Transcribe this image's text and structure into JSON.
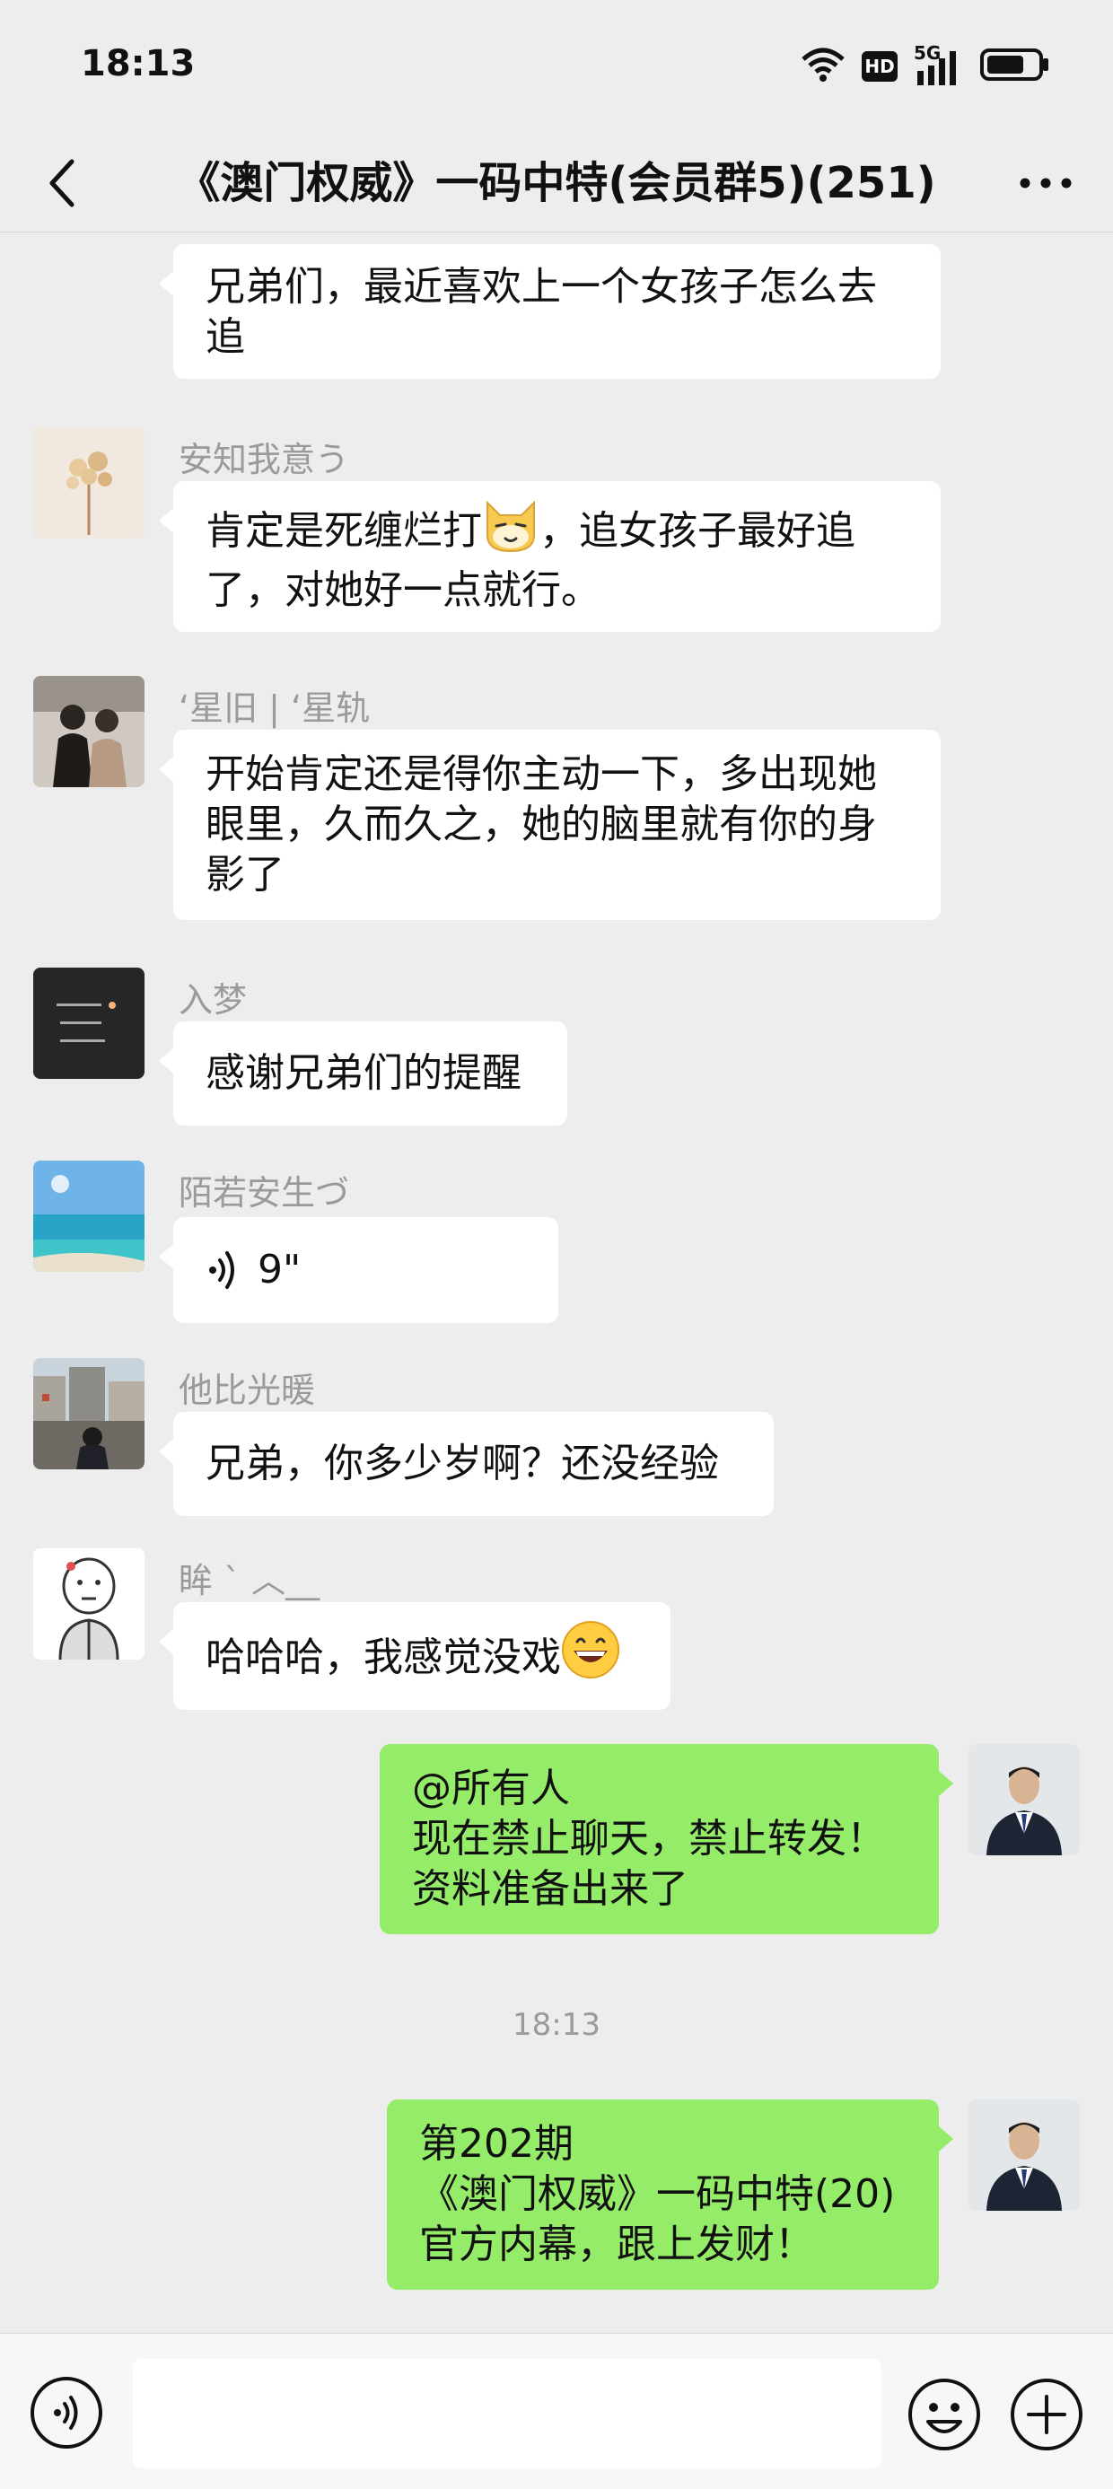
{
  "status_bar": {
    "time": "18:13",
    "icons": [
      "wifi-icon",
      "hd-icon",
      "signal-5g-icon",
      "battery-icon"
    ],
    "hd_label": "HD",
    "network_label": "5G"
  },
  "header": {
    "title": "《澳门权威》一码中特(会员群5)(251)",
    "back_icon": "chevron-left-icon",
    "more_icon": "more-dots-icon"
  },
  "messages": [
    {
      "sender": "",
      "direction": "in",
      "lines": [
        "兄弟们，最近喜欢上一个女孩子怎么去",
        "追"
      ]
    },
    {
      "sender": "安知我意う",
      "direction": "in",
      "lines": [
        "肯定是死缠烂打",
        "，追女孩子最好追",
        "了，对她好一点就行。"
      ],
      "emoji": "cat-face-emoji"
    },
    {
      "sender": "‘星旧 | ‘星轨",
      "direction": "in",
      "lines": [
        "开始肯定还是得你主动一下，多出现她",
        "眼里，久而久之，她的脑里就有你的身",
        "影了"
      ]
    },
    {
      "sender": "入梦",
      "direction": "in",
      "lines": [
        "感谢兄弟们的提醒"
      ]
    },
    {
      "sender": "陌若安生づ",
      "direction": "in",
      "type": "voice",
      "duration": "9\""
    },
    {
      "sender": "他比光暖",
      "direction": "in",
      "lines": [
        "兄弟，你多少岁啊？还没经验"
      ]
    },
    {
      "sender": "眸 ` ︿__",
      "direction": "in",
      "lines": [
        "哈哈哈，我感觉没戏"
      ],
      "emoji": "grinning-face-emoji"
    },
    {
      "sender": "",
      "direction": "out",
      "lines": [
        "@所有人",
        "现在禁止聊天，禁止转发！",
        "资料准备出来了"
      ]
    },
    {
      "type": "timestamp",
      "text": "18:13"
    },
    {
      "sender": "",
      "direction": "out",
      "lines": [
        "第202期",
        "《澳门权威》一码中特(20)",
        "官方内幕，跟上发财！"
      ]
    }
  ],
  "input_bar": {
    "voice_icon": "voice-input-icon",
    "emoji_icon": "emoji-icon",
    "plus_icon": "plus-icon",
    "input_value": ""
  },
  "colors": {
    "background": "#ededed",
    "incoming_bubble": "#ffffff",
    "outgoing_bubble": "#95ec69",
    "nickname": "#9a9a9a"
  }
}
